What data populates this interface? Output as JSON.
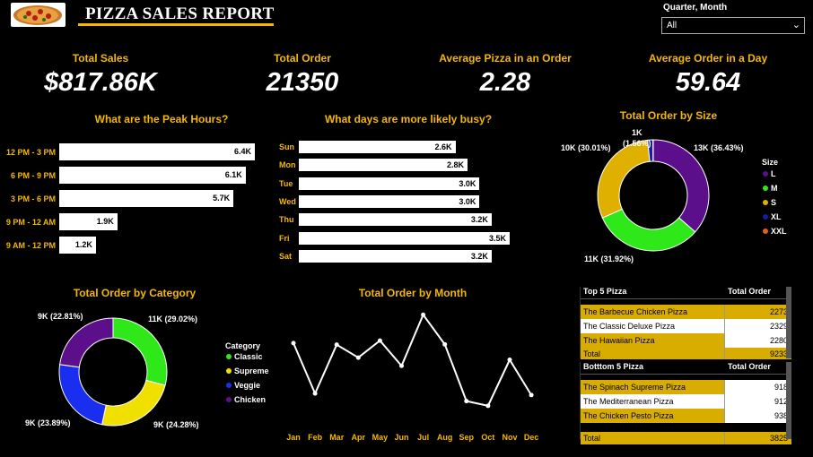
{
  "header": {
    "title": "PIZZA SALES REPORT",
    "filter_label": "Quarter, Month",
    "filter_value": "All"
  },
  "kpis": [
    {
      "label": "Total Sales",
      "value": "$817.86K"
    },
    {
      "label": "Total Order",
      "value": "21350"
    },
    {
      "label": "Average Pizza in an Order",
      "value": "2.28"
    },
    {
      "label": "Average Order in a Day",
      "value": "59.64"
    }
  ],
  "peak_hours": {
    "title": "What are the Peak Hours?",
    "rows": [
      {
        "label": "12 PM - 3 PM",
        "value": "6.4K"
      },
      {
        "label": "6 PM - 9 PM",
        "value": "6.1K"
      },
      {
        "label": "3 PM - 6 PM",
        "value": "5.7K"
      },
      {
        "label": "9 PM - 12 AM",
        "value": "1.9K"
      },
      {
        "label": "9 AM - 12 PM",
        "value": "1.2K"
      }
    ]
  },
  "busy_days": {
    "title": "What days are more likely busy?",
    "rows": [
      {
        "label": "Sun",
        "value": "2.6K"
      },
      {
        "label": "Mon",
        "value": "2.8K"
      },
      {
        "label": "Tue",
        "value": "3.0K"
      },
      {
        "label": "Wed",
        "value": "3.0K"
      },
      {
        "label": "Thu",
        "value": "3.2K"
      },
      {
        "label": "Fri",
        "value": "3.5K"
      },
      {
        "label": "Sat",
        "value": "3.2K"
      }
    ]
  },
  "size_chart": {
    "title": "Total Order by Size",
    "legend_title": "Size",
    "legend": [
      {
        "name": "L",
        "color": "#5c0f8b"
      },
      {
        "name": "M",
        "color": "#2ee81a"
      },
      {
        "name": "S",
        "color": "#e0b000"
      },
      {
        "name": "XL",
        "color": "#1a1aa8"
      },
      {
        "name": "XXL",
        "color": "#e06020"
      }
    ],
    "labels": [
      "13K (36.43%)",
      "11K (31.92%)",
      "10K (30.01%)",
      "1K",
      "(1.56%)"
    ]
  },
  "category_chart": {
    "title": "Total Order by Category",
    "legend_title": "Category",
    "legend": [
      {
        "name": "Classic",
        "color": "#2ee81a"
      },
      {
        "name": "Supreme",
        "color": "#f0e000"
      },
      {
        "name": "Veggie",
        "color": "#1a2ef0"
      },
      {
        "name": "Chicken",
        "color": "#5c0f8b"
      }
    ],
    "labels": [
      "11K (29.02%)",
      "9K (24.28%)",
      "9K (23.89%)",
      "9K (22.81%)"
    ]
  },
  "month_chart": {
    "title": "Total Order by Month",
    "months": [
      "Jan",
      "Feb",
      "Mar",
      "Apr",
      "May",
      "Jun",
      "Jul",
      "Aug",
      "Sep",
      "Oct",
      "Nov",
      "Dec"
    ]
  },
  "top5": {
    "head_name": "Top 5 Pizza",
    "head_val": "Total Order",
    "rows": [
      {
        "name": "The Barbecue Chicken Pizza",
        "value": "2273"
      },
      {
        "name": "The Classic Deluxe Pizza",
        "value": "2329"
      },
      {
        "name": "The Hawaiian Pizza",
        "value": "2280"
      },
      {
        "name": "Total",
        "value": "9233"
      }
    ]
  },
  "bottom5": {
    "head_name": "Botttom 5 Pizza",
    "head_val": "Total Order",
    "rows": [
      {
        "name": "The Spinach Supreme Pizza",
        "value": "918"
      },
      {
        "name": "The Mediterranean Pizza",
        "value": "912"
      },
      {
        "name": "The Chicken Pesto Pizza",
        "value": "938"
      },
      {
        "name": "Total",
        "value": "3825"
      }
    ]
  },
  "chart_data": [
    {
      "type": "bar",
      "title": "What are the Peak Hours?",
      "categories": [
        "12 PM - 3 PM",
        "6 PM - 9 PM",
        "3 PM - 6 PM",
        "9 PM - 12 AM",
        "9 AM - 12 PM"
      ],
      "values": [
        6400,
        6100,
        5700,
        1900,
        1200
      ]
    },
    {
      "type": "bar",
      "title": "What days are more likely busy?",
      "categories": [
        "Sun",
        "Mon",
        "Tue",
        "Wed",
        "Thu",
        "Fri",
        "Sat"
      ],
      "values": [
        2600,
        2800,
        3000,
        3000,
        3200,
        3500,
        3200
      ]
    },
    {
      "type": "pie",
      "title": "Total Order by Size",
      "categories": [
        "L",
        "M",
        "S",
        "XL",
        "XXL"
      ],
      "values": [
        36.43,
        31.92,
        30.01,
        1.56,
        0.08
      ]
    },
    {
      "type": "pie",
      "title": "Total Order by Category",
      "categories": [
        "Classic",
        "Supreme",
        "Veggie",
        "Chicken"
      ],
      "values": [
        29.02,
        24.28,
        23.89,
        22.81
      ]
    },
    {
      "type": "line",
      "title": "Total Order by Month",
      "x": [
        "Jan",
        "Feb",
        "Mar",
        "Apr",
        "May",
        "Jun",
        "Jul",
        "Aug",
        "Sep",
        "Oct",
        "Nov",
        "Dec"
      ],
      "values": [
        1845,
        1685,
        1840,
        1799,
        1853,
        1773,
        1935,
        1841,
        1661,
        1646,
        1792,
        1680
      ]
    }
  ]
}
